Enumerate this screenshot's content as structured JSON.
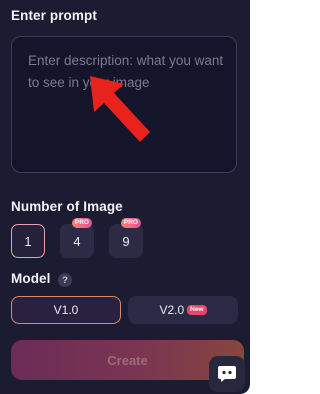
{
  "prompt": {
    "title": "Enter prompt",
    "placeholder": "Enter description: what you want to see in your image"
  },
  "number_of_image": {
    "title": "Number of Image",
    "options": [
      {
        "label": "1",
        "badge": "",
        "selected": true
      },
      {
        "label": "4",
        "badge": "PRO",
        "selected": false
      },
      {
        "label": "9",
        "badge": "PRO",
        "selected": false
      }
    ]
  },
  "model": {
    "title": "Model",
    "help_icon": "?",
    "options": [
      {
        "label": "V1.0",
        "badge": "",
        "selected": true
      },
      {
        "label": "V2.0",
        "badge": "New",
        "selected": false
      }
    ]
  },
  "create_button": {
    "label": "Create",
    "enabled": false
  },
  "chat_icon": "chat-bubble-icon",
  "annotation_icon": "red-arrow-icon",
  "colors": {
    "panel_bg": "#1b1b32",
    "accent_gradient_start": "#6b2c57",
    "accent_gradient_end": "#87463f",
    "arrow": "#e8231e"
  }
}
